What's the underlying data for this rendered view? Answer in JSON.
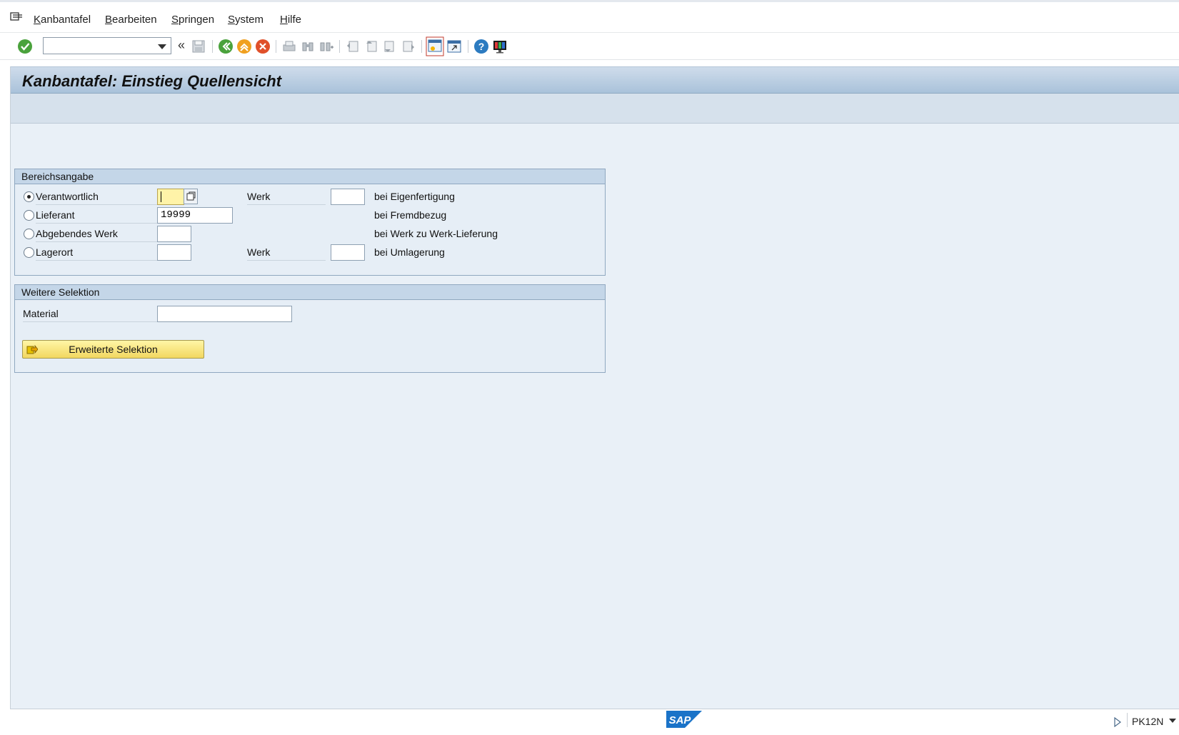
{
  "menu": {
    "items": [
      "Kanbantafel",
      "Bearbeiten",
      "Springen",
      "System",
      "Hilfe"
    ]
  },
  "toolbar": {
    "command_field_value": "",
    "icons": [
      "enter-icon",
      "save-icon",
      "back-icon",
      "exit-icon",
      "cancel-icon",
      "print-icon",
      "find-icon",
      "find-next-icon",
      "first-page-icon",
      "prev-page-icon",
      "next-page-icon",
      "last-page-icon",
      "new-session-icon",
      "shortcut-icon",
      "help-icon",
      "customize-layout-icon"
    ]
  },
  "page": {
    "title": "Kanbantafel: Einstieg Quellensicht"
  },
  "bereich": {
    "header": "Bereichsangabe",
    "rows": [
      {
        "label": "Verantwortlich",
        "selected": true,
        "value": "",
        "werk_label": "Werk",
        "suffix": "bei Eigenfertigung"
      },
      {
        "label": "Lieferant",
        "selected": false,
        "value": "19999",
        "werk_label": "",
        "suffix": "bei Fremdbezug"
      },
      {
        "label": "Abgebendes Werk",
        "selected": false,
        "value": "",
        "werk_label": "",
        "suffix": "bei Werk zu Werk-Lieferung"
      },
      {
        "label": "Lagerort",
        "selected": false,
        "value": "",
        "werk_label": "Werk",
        "suffix": "bei Umlagerung"
      }
    ]
  },
  "weitere": {
    "header": "Weitere Selektion",
    "material_label": "Material",
    "material_value": "",
    "button_label": "Erweiterte Selektion"
  },
  "status": {
    "logo": "SAP",
    "transaction": "PK12N"
  },
  "colors": {
    "accent": "#a9c2da",
    "panel_bg": "#e9f0f7",
    "focus_field": "#fff3a8",
    "button_yellow": "#f2d760"
  }
}
